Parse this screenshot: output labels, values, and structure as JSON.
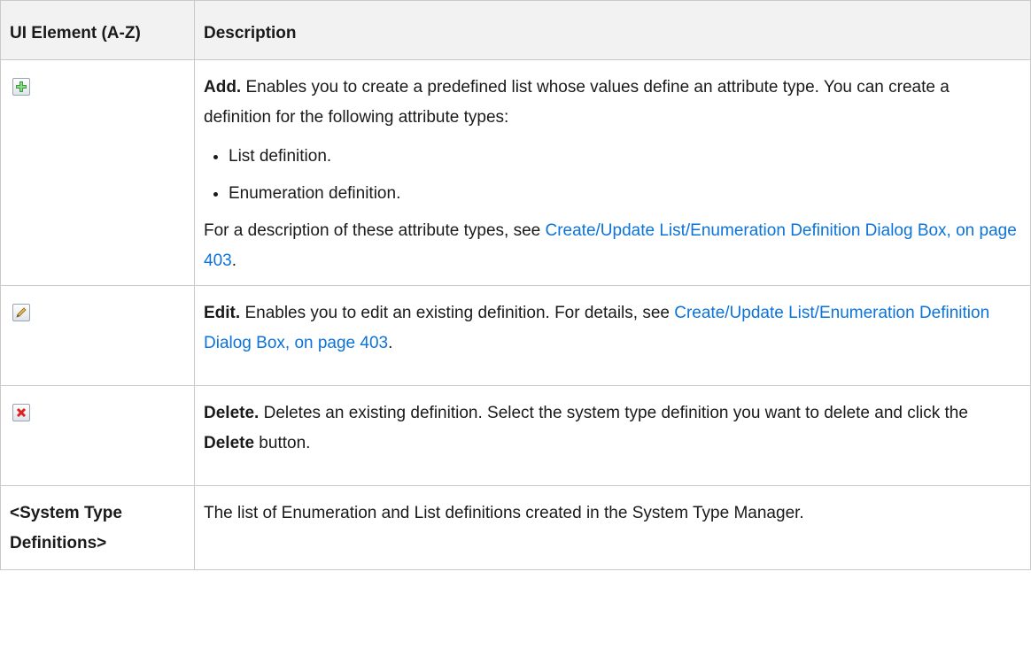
{
  "header": {
    "col1": "UI Element (A-Z)",
    "col2": "Description"
  },
  "rows": {
    "add": {
      "icon": "add-icon",
      "title": "Add.",
      "text1": " Enables you to create a predefined list whose values define an attribute type. You can create a definition for the following attribute types:",
      "bullets": [
        "List definition.",
        "Enumeration definition."
      ],
      "text2_prefix": "For a description of these attribute types, see ",
      "link": "Create/Update List/Enumeration Definition Dialog Box, on page 403",
      "text2_suffix": "."
    },
    "edit": {
      "icon": "edit-icon",
      "title": "Edit.",
      "text1": " Enables you to edit an existing definition. For details, see ",
      "link": "Create/Update List/Enumeration Definition Dialog Box, on page 403",
      "text1_suffix": "."
    },
    "delete": {
      "icon": "delete-icon",
      "title": "Delete.",
      "text1": " Deletes an existing definition. Select the system type definition you want to delete and click the ",
      "bold_word": "Delete",
      "text1_suffix": " button."
    },
    "definitions": {
      "label": "<System Type Definitions>",
      "text": "The list of Enumeration and List definitions created in the System Type Manager."
    }
  },
  "colors": {
    "link": "#0b73d9",
    "header_bg": "#f2f2f2",
    "border": "#c9c9c9"
  }
}
